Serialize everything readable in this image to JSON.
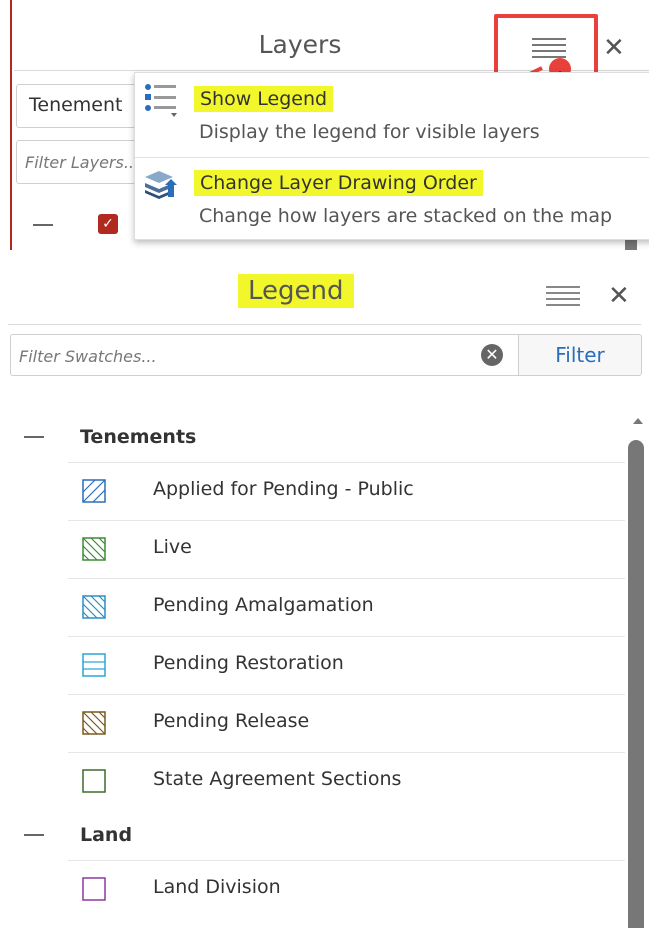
{
  "layers_panel": {
    "title": "Layers",
    "select_value": "Tenement",
    "filter_placeholder": "Filter Layers...",
    "menu": [
      {
        "title": "Show Legend",
        "description": "Display the legend for visible layers",
        "icon": "legend-list-icon"
      },
      {
        "title": "Change Layer Drawing Order",
        "description": "Change how layers are stacked on the map",
        "icon": "layer-stack-icon"
      }
    ]
  },
  "legend_panel": {
    "title": "Legend",
    "filter_placeholder": "Filter Swatches...",
    "filter_button": "Filter",
    "groups": [
      {
        "name": "Tenements",
        "items": [
          {
            "label": "Applied for Pending - Public",
            "color": "#2a6ebb",
            "pattern": "hatch-forward"
          },
          {
            "label": "Live",
            "color": "#3d8b37",
            "pattern": "hatch-back"
          },
          {
            "label": "Pending Amalgamation",
            "color": "#2a8fc7",
            "pattern": "hatch-back"
          },
          {
            "label": "Pending Restoration",
            "color": "#2aa6d6",
            "pattern": "horizontal"
          },
          {
            "label": "Pending Release",
            "color": "#7a5a1e",
            "pattern": "hatch-back"
          },
          {
            "label": "State Agreement Sections",
            "color": "#3d6b2a",
            "pattern": "none"
          }
        ]
      },
      {
        "name": "Land",
        "items": [
          {
            "label": "Land Division",
            "color": "#8e3a9e",
            "pattern": "none"
          }
        ]
      }
    ]
  },
  "colors": {
    "highlight": "#f2f72b",
    "annotation_red": "#e8403a",
    "checkbox_red": "#b02a1f",
    "link_blue": "#2a6ebb"
  }
}
